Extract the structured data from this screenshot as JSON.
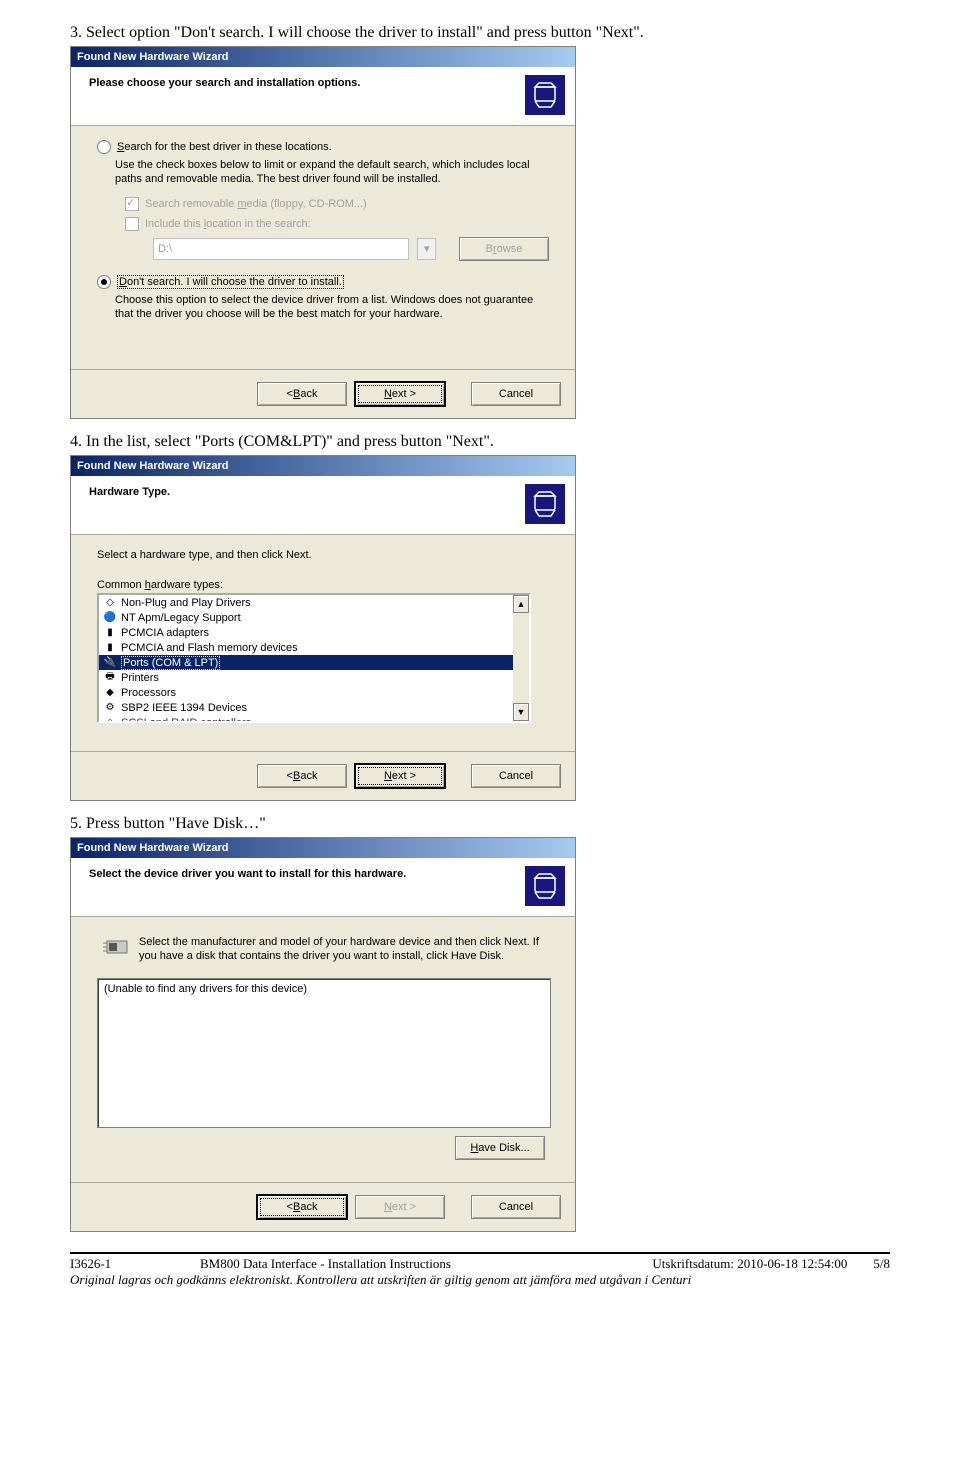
{
  "steps": {
    "s3": "3. Select option \"Don't search. I will choose the driver to install\" and press button \"Next\".",
    "s4": "4. In the list, select \"Ports (COM&LPT)\" and press button \"Next\".",
    "s5": "5. Press button \"Have Disk…\""
  },
  "wizard": {
    "title": "Found New Hardware Wizard",
    "btn_back": "< Back",
    "btn_next": "Next >",
    "btn_cancel": "Cancel"
  },
  "dlg1": {
    "header": "Please choose your search and installation options.",
    "opt1_label": "Search for the best driver in these locations.",
    "opt1_text": "Use the check boxes below to limit or expand the default search, which includes local paths and removable media. The best driver found will be installed.",
    "chk1": "Search removable media (floppy, CD-ROM...)",
    "chk2": "Include this location in the search:",
    "path": "D:\\",
    "browse": "Browse",
    "opt2_label": "Don't search. I will choose the driver to install.",
    "opt2_text": "Choose this option to select the device driver from a list. Windows does not guarantee that the driver you choose will be the best match for your hardware."
  },
  "dlg2": {
    "header": "Hardware Type.",
    "prompt": "Select a hardware type, and then click Next.",
    "caption": "Common hardware types:",
    "items": [
      "Non-Plug and Play Drivers",
      "NT Apm/Legacy Support",
      "PCMCIA adapters",
      "PCMCIA and Flash memory devices",
      "Ports (COM & LPT)",
      "Printers",
      "Processors",
      "SBP2 IEEE 1394 Devices",
      "SCSI and RAID controllers"
    ]
  },
  "dlg3": {
    "header": "Select the device driver you want to install for this hardware.",
    "info": "Select the manufacturer and model of your hardware device and then click Next. If you have a disk that contains the driver you want to install, click Have Disk.",
    "empty": "(Unable to find any drivers for this device)",
    "have_disk": "Have Disk..."
  },
  "footer": {
    "doc_id": "I3626-1",
    "doc_title": "BM800 Data Interface - Installation Instructions",
    "print_label": "Utskriftsdatum: 2010-06-18 12:54:00",
    "page": "5/8",
    "note": "Original lagras och godkänns elektroniskt. Kontrollera att utskriften är giltig genom att jämföra med utgåvan i Centuri"
  }
}
